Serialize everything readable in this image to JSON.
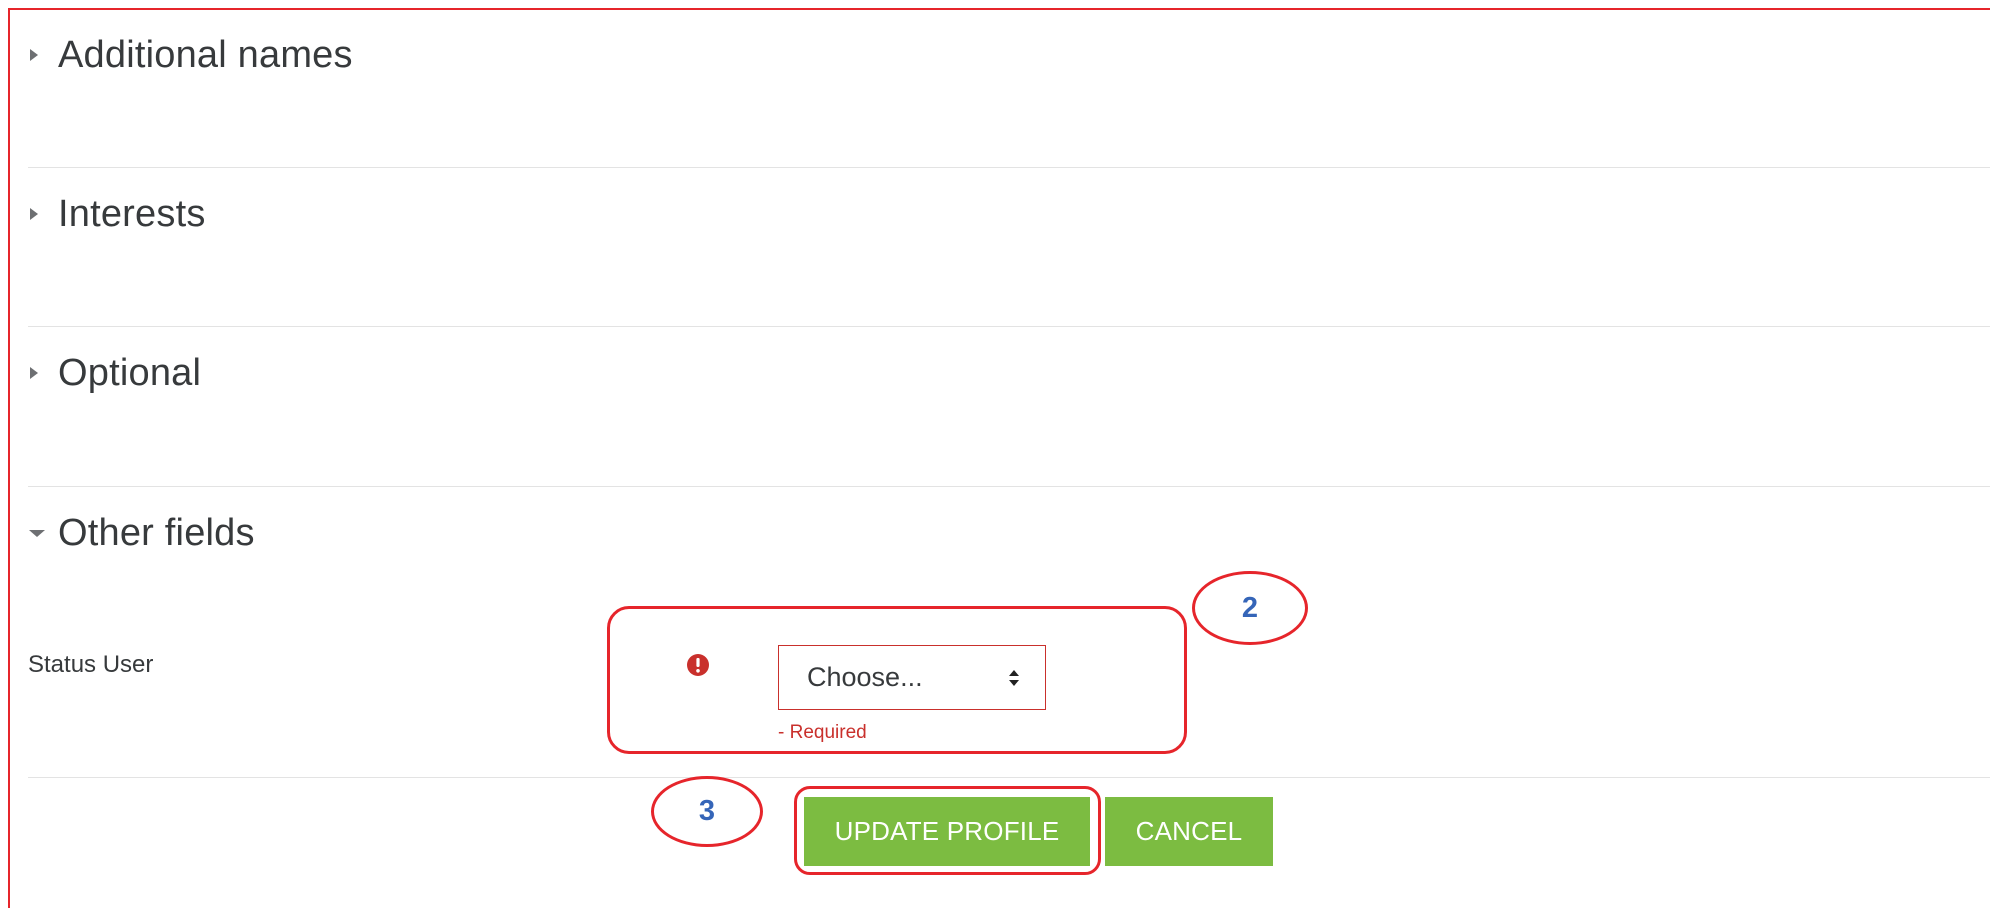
{
  "sections": [
    {
      "title": "Additional names",
      "expanded": false
    },
    {
      "title": "Interests",
      "expanded": false
    },
    {
      "title": "Optional",
      "expanded": false
    },
    {
      "title": "Other fields",
      "expanded": true
    }
  ],
  "other_fields": {
    "status_user_label": "Status User",
    "select_value": "Choose...",
    "required_text": "- Required"
  },
  "actions": {
    "update_label": "UPDATE PROFILE",
    "cancel_label": "CANCEL"
  },
  "annotations": {
    "marker_2": "2",
    "marker_3": "3"
  },
  "colors": {
    "frame_border": "#e6252b",
    "button_green": "#7cbc41",
    "error_red": "#c9302c",
    "annotation_number": "#3565b8"
  }
}
